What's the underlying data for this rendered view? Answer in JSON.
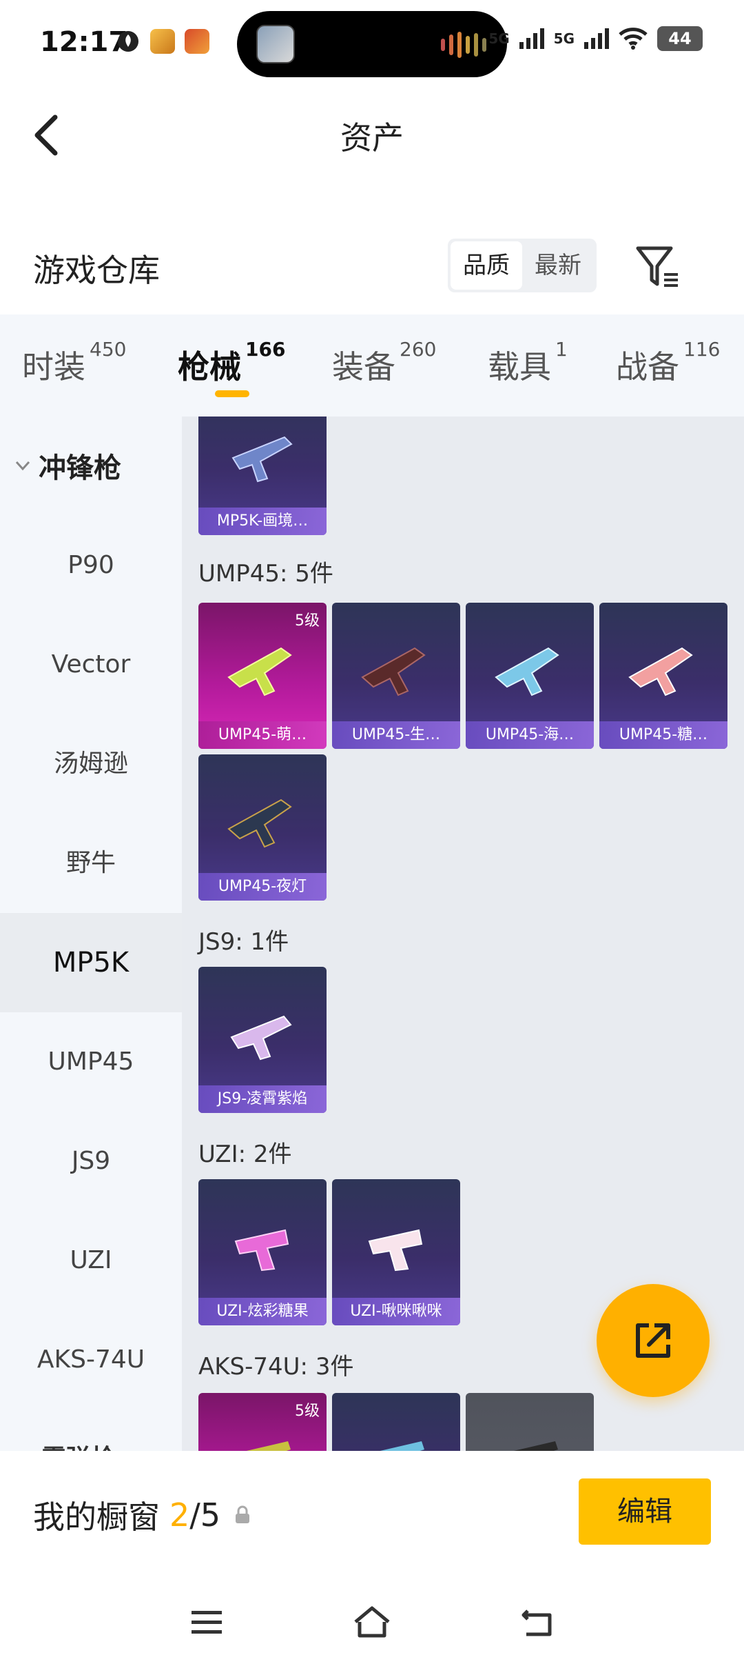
{
  "status_bar": {
    "time": "12:17",
    "signal1": "5G",
    "signal2": "5G",
    "battery": "44"
  },
  "header": {
    "title": "资产"
  },
  "repo": {
    "title": "游戏仓库",
    "sort_options": [
      "品质",
      "最新"
    ]
  },
  "tabs": [
    {
      "label": "时装",
      "count": "450"
    },
    {
      "label": "枪械",
      "count": "166"
    },
    {
      "label": "装备",
      "count": "260"
    },
    {
      "label": "载具",
      "count": "1"
    },
    {
      "label": "战备",
      "count": "116"
    }
  ],
  "sidebar": {
    "group": "冲锋枪",
    "items": [
      "P90",
      "Vector",
      "汤姆逊",
      "野牛",
      "MP5K",
      "UMP45",
      "JS9",
      "UZI",
      "AKS-74U"
    ],
    "next_group_partial": "霰弹枪"
  },
  "content": {
    "top_card": "MP5K-画境…",
    "groups": [
      {
        "label": "UMP45: 5件",
        "cards": [
          "UMP45-萌…",
          "UMP45-生…",
          "UMP45-海…",
          "UMP45-糖…",
          "UMP45-夜灯"
        ],
        "first_level": "5级"
      },
      {
        "label": "JS9: 1件",
        "cards": [
          "JS9-凌霄紫焰"
        ]
      },
      {
        "label": "UZI: 2件",
        "cards": [
          "UZI-炫彩糖果",
          "UZI-啾咪啾咪"
        ]
      },
      {
        "label": "AKS-74U: 3件",
        "first_level": "5级"
      }
    ]
  },
  "bottom": {
    "showcase_label": "我的橱窗",
    "current": "2",
    "total": "/5",
    "edit_label": "编辑"
  },
  "colors": {
    "accent": "#ffb000",
    "card_purple": "#3b2e6a",
    "card_pink": "#b21a9a"
  }
}
